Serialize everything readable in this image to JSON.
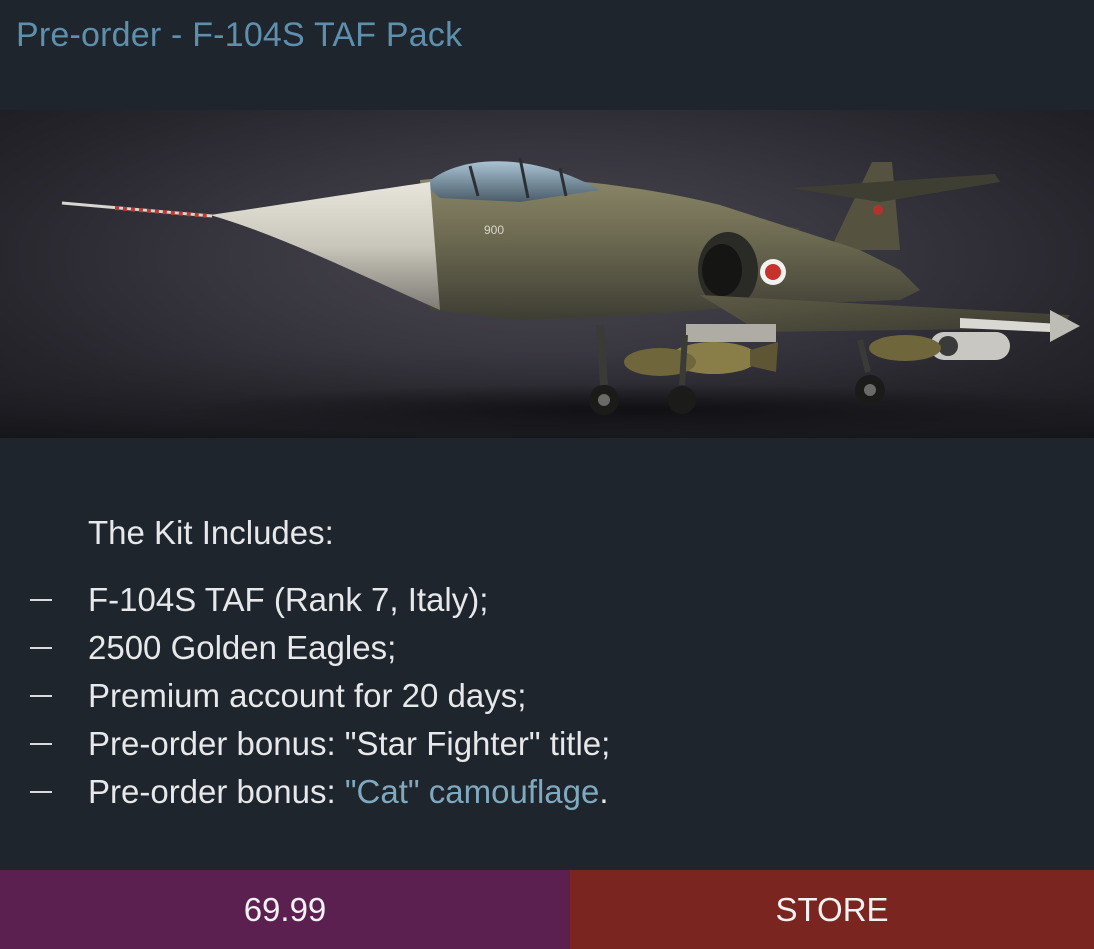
{
  "header": {
    "title": "Pre-order - F-104S TAF Pack"
  },
  "hero": {
    "image": "jet-aircraft-illustration",
    "aircraft_marking": "900"
  },
  "kit": {
    "heading": "The Kit Includes:",
    "items": [
      {
        "text": "F-104S TAF (Rank 7, Italy);"
      },
      {
        "text": "2500 Golden Eagles;"
      },
      {
        "text": "Premium account for 20 days;"
      },
      {
        "text": "Pre-order bonus: \"Star Fighter\" title;"
      },
      {
        "prefix": "Pre-order bonus: ",
        "link": "\"Cat\" camouflage",
        "suffix": "."
      }
    ]
  },
  "footer": {
    "price_label": "69.99",
    "store_label": "STORE"
  },
  "colors": {
    "background": "#1f252d",
    "title": "#5e90ad",
    "link": "#7ea9bf",
    "price_button": "#5b1f50",
    "store_button": "#7a2520"
  }
}
